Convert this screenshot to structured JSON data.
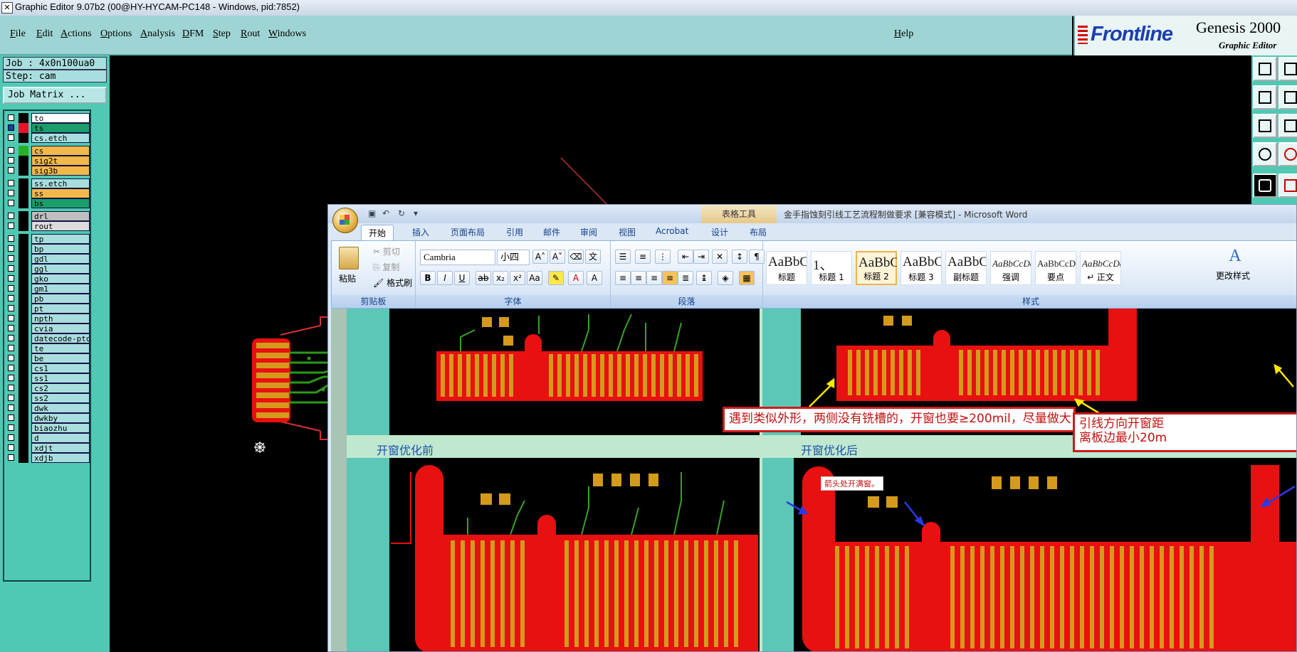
{
  "window": {
    "title": "Graphic Editor 9.07b2 (00@HY-HYCAM-PC148 - Windows, pid:7852)"
  },
  "menubar": {
    "items": [
      "File",
      "Edit",
      "Actions",
      "Options",
      "Analysis",
      "DFM",
      "Step",
      "Rout",
      "Windows"
    ],
    "help": "Help"
  },
  "brand": {
    "logo": "Frontline",
    "product": "Genesis 2000",
    "subtitle": "Graphic Editor"
  },
  "job": {
    "job_label": "Job : 4x0n100ua0",
    "step_label": "Step: cam",
    "matrix_button": "Job Matrix ..."
  },
  "layers": [
    {
      "name": "to",
      "bg": "#ffffff",
      "swatch": "#000000"
    },
    {
      "name": "ts",
      "bg": "#1a9e6a",
      "swatch": "#e8132a",
      "checked": true
    },
    {
      "name": "cs.etch",
      "bg": "#a9dede",
      "swatch": "#000000"
    },
    {
      "name": "cs",
      "bg": "#f2b94a",
      "swatch": "#28b028"
    },
    {
      "name": "sig2t",
      "bg": "#f2b94a",
      "swatch": "#000000"
    },
    {
      "name": "sig3b",
      "bg": "#f2b94a",
      "swatch": "#000000"
    },
    {
      "name": "ss.etch",
      "bg": "#a9dede",
      "swatch": "#000000"
    },
    {
      "name": "ss",
      "bg": "#f2b94a",
      "swatch": "#000000"
    },
    {
      "name": "bs",
      "bg": "#1a9e6a",
      "swatch": "#000000"
    },
    {
      "name": "drl",
      "bg": "#bfbfbf",
      "swatch": "#000000"
    },
    {
      "name": "rout",
      "bg": "#dcdcdc",
      "swatch": "#000000"
    },
    {
      "name": "tp",
      "bg": "#a9dede",
      "swatch": "#000000"
    },
    {
      "name": "bp",
      "bg": "#a9dede",
      "swatch": "#000000"
    },
    {
      "name": "gdl",
      "bg": "#a9dede",
      "swatch": "#000000"
    },
    {
      "name": "ggl",
      "bg": "#a9dede",
      "swatch": "#000000"
    },
    {
      "name": "gko",
      "bg": "#a9dede",
      "swatch": "#000000"
    },
    {
      "name": "gm1",
      "bg": "#a9dede",
      "swatch": "#000000"
    },
    {
      "name": "pb",
      "bg": "#a9dede",
      "swatch": "#000000"
    },
    {
      "name": "pt",
      "bg": "#a9dede",
      "swatch": "#000000"
    },
    {
      "name": "npth",
      "bg": "#a9dede",
      "swatch": "#000000"
    },
    {
      "name": "cvia",
      "bg": "#a9dede",
      "swatch": "#000000"
    },
    {
      "name": "datecode-pto",
      "bg": "#a9dede",
      "swatch": "#000000"
    },
    {
      "name": "te",
      "bg": "#a9dede",
      "swatch": "#000000"
    },
    {
      "name": "be",
      "bg": "#a9dede",
      "swatch": "#000000"
    },
    {
      "name": "cs1",
      "bg": "#a9dede",
      "swatch": "#000000"
    },
    {
      "name": "ss1",
      "bg": "#a9dede",
      "swatch": "#000000"
    },
    {
      "name": "cs2",
      "bg": "#a9dede",
      "swatch": "#000000"
    },
    {
      "name": "ss2",
      "bg": "#a9dede",
      "swatch": "#000000"
    },
    {
      "name": "dwk",
      "bg": "#a9dede",
      "swatch": "#000000"
    },
    {
      "name": "dwkby",
      "bg": "#a9dede",
      "swatch": "#000000"
    },
    {
      "name": "biaozhu",
      "bg": "#a9dede",
      "swatch": "#000000"
    },
    {
      "name": "d",
      "bg": "#a9dede",
      "swatch": "#000000"
    },
    {
      "name": "xdjt",
      "bg": "#a9dede",
      "swatch": "#000000"
    },
    {
      "name": "xdjb",
      "bg": "#a9dede",
      "swatch": "#000000"
    }
  ],
  "word": {
    "contextual_tab": "表格工具",
    "doc_title": "金手指蚀刻引线工艺流程制做要求 [兼容模式] - Microsoft Word",
    "tabs": [
      "开始",
      "插入",
      "页面布局",
      "引用",
      "邮件",
      "审阅",
      "视图",
      "Acrobat",
      "设计",
      "布局"
    ],
    "clipboard": {
      "paste": "粘贴",
      "cut": "剪切",
      "copy": "复制",
      "format_painter": "格式刷",
      "group": "剪贴板"
    },
    "font": {
      "name": "Cambria",
      "size": "小四",
      "group": "字体"
    },
    "paragraph": {
      "group": "段落"
    },
    "styles": {
      "group": "样式",
      "change": "更改样式",
      "items": [
        {
          "sample": "AaBbC",
          "name": "标题"
        },
        {
          "sample": "1、",
          "name": "标题 1"
        },
        {
          "sample": "AaBbC",
          "name": "标题 2",
          "selected": true
        },
        {
          "sample": "AaBbC",
          "name": "标题 3"
        },
        {
          "sample": "AaBbC",
          "name": "副标题"
        },
        {
          "sample": "AaBbCcDd",
          "name": "强调"
        },
        {
          "sample": "AaBbCcD",
          "name": "要点"
        },
        {
          "sample": "AaBbCcDd",
          "name": "↵ 正文"
        }
      ]
    },
    "document": {
      "note_top": "遇到类似外形，两侧没有铣槽的，开窗也要≥200mil，尽量做大",
      "note_right_line1": "引线方向开窗距",
      "note_right_line2": "离板边最小20m",
      "caption_before": "开窗优化前",
      "caption_after": "开窗优化后",
      "small_note": "箭头处开满窗。"
    }
  }
}
